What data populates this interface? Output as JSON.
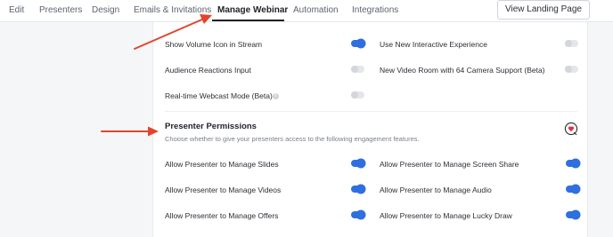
{
  "tabs": [
    {
      "label": "Edit",
      "active": false
    },
    {
      "label": "Presenters",
      "active": false
    },
    {
      "label": "Design",
      "active": false
    },
    {
      "label": "Emails & Invitations",
      "active": false
    },
    {
      "label": "Manage Webinar",
      "active": true
    },
    {
      "label": "Automation",
      "active": false
    },
    {
      "label": "Integrations",
      "active": false
    }
  ],
  "landing_button": "View Landing Page",
  "settings": {
    "show_volume_icon": {
      "label": "Show Volume Icon in Stream",
      "enabled": true
    },
    "new_interactive": {
      "label": "Use New Interactive Experience",
      "enabled": false
    },
    "audience_reactions": {
      "label": "Audience Reactions Input",
      "enabled": false
    },
    "video_room_64": {
      "label": "New Video Room with 64 Camera Support (Beta)",
      "enabled": false
    },
    "realtime_webcast": {
      "label": "Real-time Webcast Mode (Beta)",
      "enabled": false
    }
  },
  "presenter_permissions": {
    "title": "Presenter Permissions",
    "description": "Choose whether to give your presenters access to the following engagement features.",
    "items": {
      "slides": {
        "label": "Allow Presenter to Manage Slides",
        "enabled": true
      },
      "screen_share": {
        "label": "Allow Presenter to Manage Screen Share",
        "enabled": true
      },
      "videos": {
        "label": "Allow Presenter to Manage Videos",
        "enabled": true
      },
      "audio": {
        "label": "Allow Presenter to Manage Audio",
        "enabled": true
      },
      "offers": {
        "label": "Allow Presenter to Manage Offers",
        "enabled": true
      },
      "lucky_draw": {
        "label": "Allow Presenter to Manage Lucky Draw",
        "enabled": true
      }
    }
  },
  "icons": {
    "info": "info-icon",
    "help": "heart-help-icon"
  },
  "colors": {
    "toggle_on": "#2f6fe0",
    "toggle_off": "#e4e6ea",
    "annotation_arrow": "#e2452b",
    "help_icon": "#d7364d"
  }
}
